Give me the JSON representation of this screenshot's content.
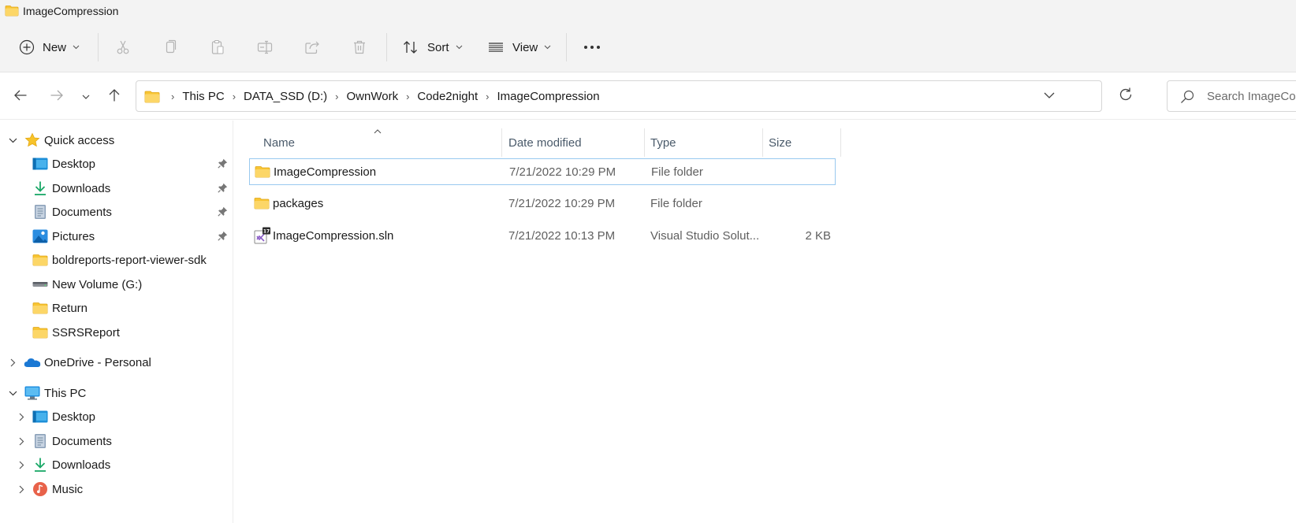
{
  "window": {
    "title": "ImageCompression"
  },
  "toolbar": {
    "new_label": "New",
    "sort_label": "Sort",
    "view_label": "View",
    "buttons": [
      "new",
      "cut",
      "copy",
      "paste",
      "rename",
      "share",
      "delete",
      "sort",
      "view",
      "more"
    ]
  },
  "address": {
    "crumbs": [
      "This PC",
      "DATA_SSD (D:)",
      "OwnWork",
      "Code2night",
      "ImageCompression"
    ],
    "search_placeholder": "Search ImageCompression"
  },
  "sidebar": {
    "quick_access": "Quick access",
    "quick_items": [
      {
        "label": "Desktop",
        "icon": "desktop-icon",
        "pinned": true
      },
      {
        "label": "Downloads",
        "icon": "download-icon",
        "pinned": true
      },
      {
        "label": "Documents",
        "icon": "documents-icon",
        "pinned": true
      },
      {
        "label": "Pictures",
        "icon": "pictures-icon",
        "pinned": true
      },
      {
        "label": "boldreports-report-viewer-sdk",
        "icon": "folder-icon",
        "pinned": false
      },
      {
        "label": "New Volume (G:)",
        "icon": "drive-icon",
        "pinned": false
      },
      {
        "label": "Return",
        "icon": "folder-icon",
        "pinned": false
      },
      {
        "label": "SSRSReport",
        "icon": "folder-icon",
        "pinned": false
      }
    ],
    "onedrive": "OneDrive - Personal",
    "this_pc": "This PC",
    "pc_items": [
      {
        "label": "Desktop",
        "icon": "desktop-icon"
      },
      {
        "label": "Documents",
        "icon": "documents-icon"
      },
      {
        "label": "Downloads",
        "icon": "download-icon"
      },
      {
        "label": "Music",
        "icon": "music-icon"
      }
    ]
  },
  "files": {
    "columns": [
      "Name",
      "Date modified",
      "Type",
      "Size"
    ],
    "rows": [
      {
        "name": "ImageCompression",
        "date": "7/21/2022 10:29 PM",
        "type": "File folder",
        "size": "",
        "icon": "folder-icon",
        "selected": true
      },
      {
        "name": "packages",
        "date": "7/21/2022 10:29 PM",
        "type": "File folder",
        "size": "",
        "icon": "folder-icon",
        "selected": false
      },
      {
        "name": "ImageCompression.sln",
        "date": "7/21/2022 10:13 PM",
        "type": "Visual Studio Solut...",
        "size": "2 KB",
        "icon": "vs-solution-icon",
        "selected": false
      }
    ]
  },
  "colors": {
    "folder": "#f8c534",
    "folder_dark": "#e8a918",
    "selection_border": "#99c9ef",
    "toolbar_bg": "#f3f3f3"
  }
}
